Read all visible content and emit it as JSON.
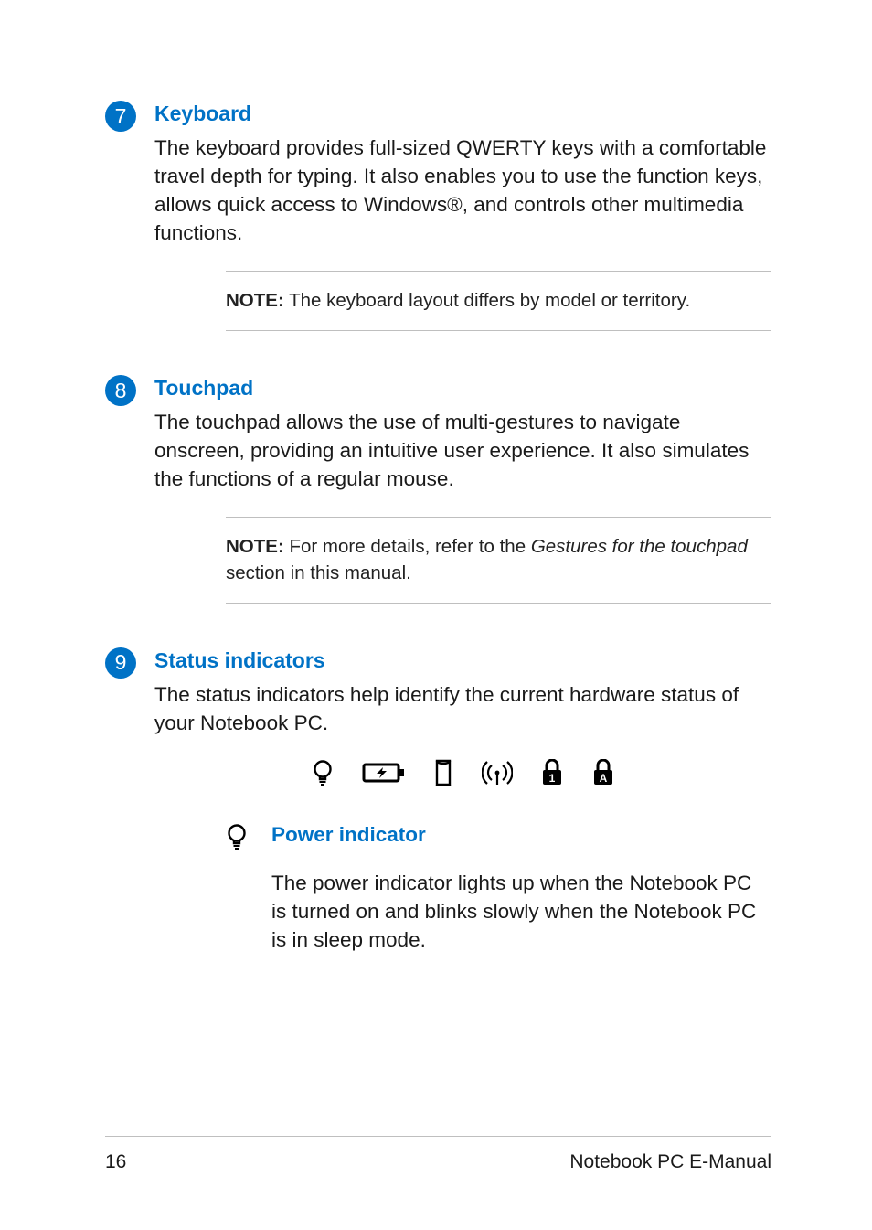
{
  "items": [
    {
      "num": "7",
      "heading": "Keyboard",
      "desc": "The keyboard provides full-sized QWERTY keys with a comfortable travel depth for typing. It also enables you to use the function keys, allows quick access to Windows®, and controls other multimedia functions.",
      "note_label": "NOTE:",
      "note_text": " The keyboard layout differs by model or territory."
    },
    {
      "num": "8",
      "heading": "Touchpad",
      "desc": "The touchpad allows the use of multi-gestures to navigate onscreen, providing an intuitive user experience. It also simulates the functions of a regular mouse.",
      "note_label": "NOTE:",
      "note_text_pre": " For more details, refer to the ",
      "note_ref": "Gestures for the touchpad",
      "note_text_post": " section in this manual."
    },
    {
      "num": "9",
      "heading": "Status indicators",
      "desc": "The status indicators help identify the current hardware status of your Notebook PC."
    }
  ],
  "status_icons": [
    "power-bulb-icon",
    "battery-charge-icon",
    "drive-activity-icon",
    "wireless-icon",
    "num-lock-icon",
    "caps-lock-icon"
  ],
  "sub": {
    "heading": "Power indicator",
    "desc": "The power indicator lights up when the Notebook PC is turned on and blinks slowly when the Notebook PC is in sleep mode."
  },
  "footer": {
    "page": "16",
    "title": "Notebook PC E-Manual"
  }
}
